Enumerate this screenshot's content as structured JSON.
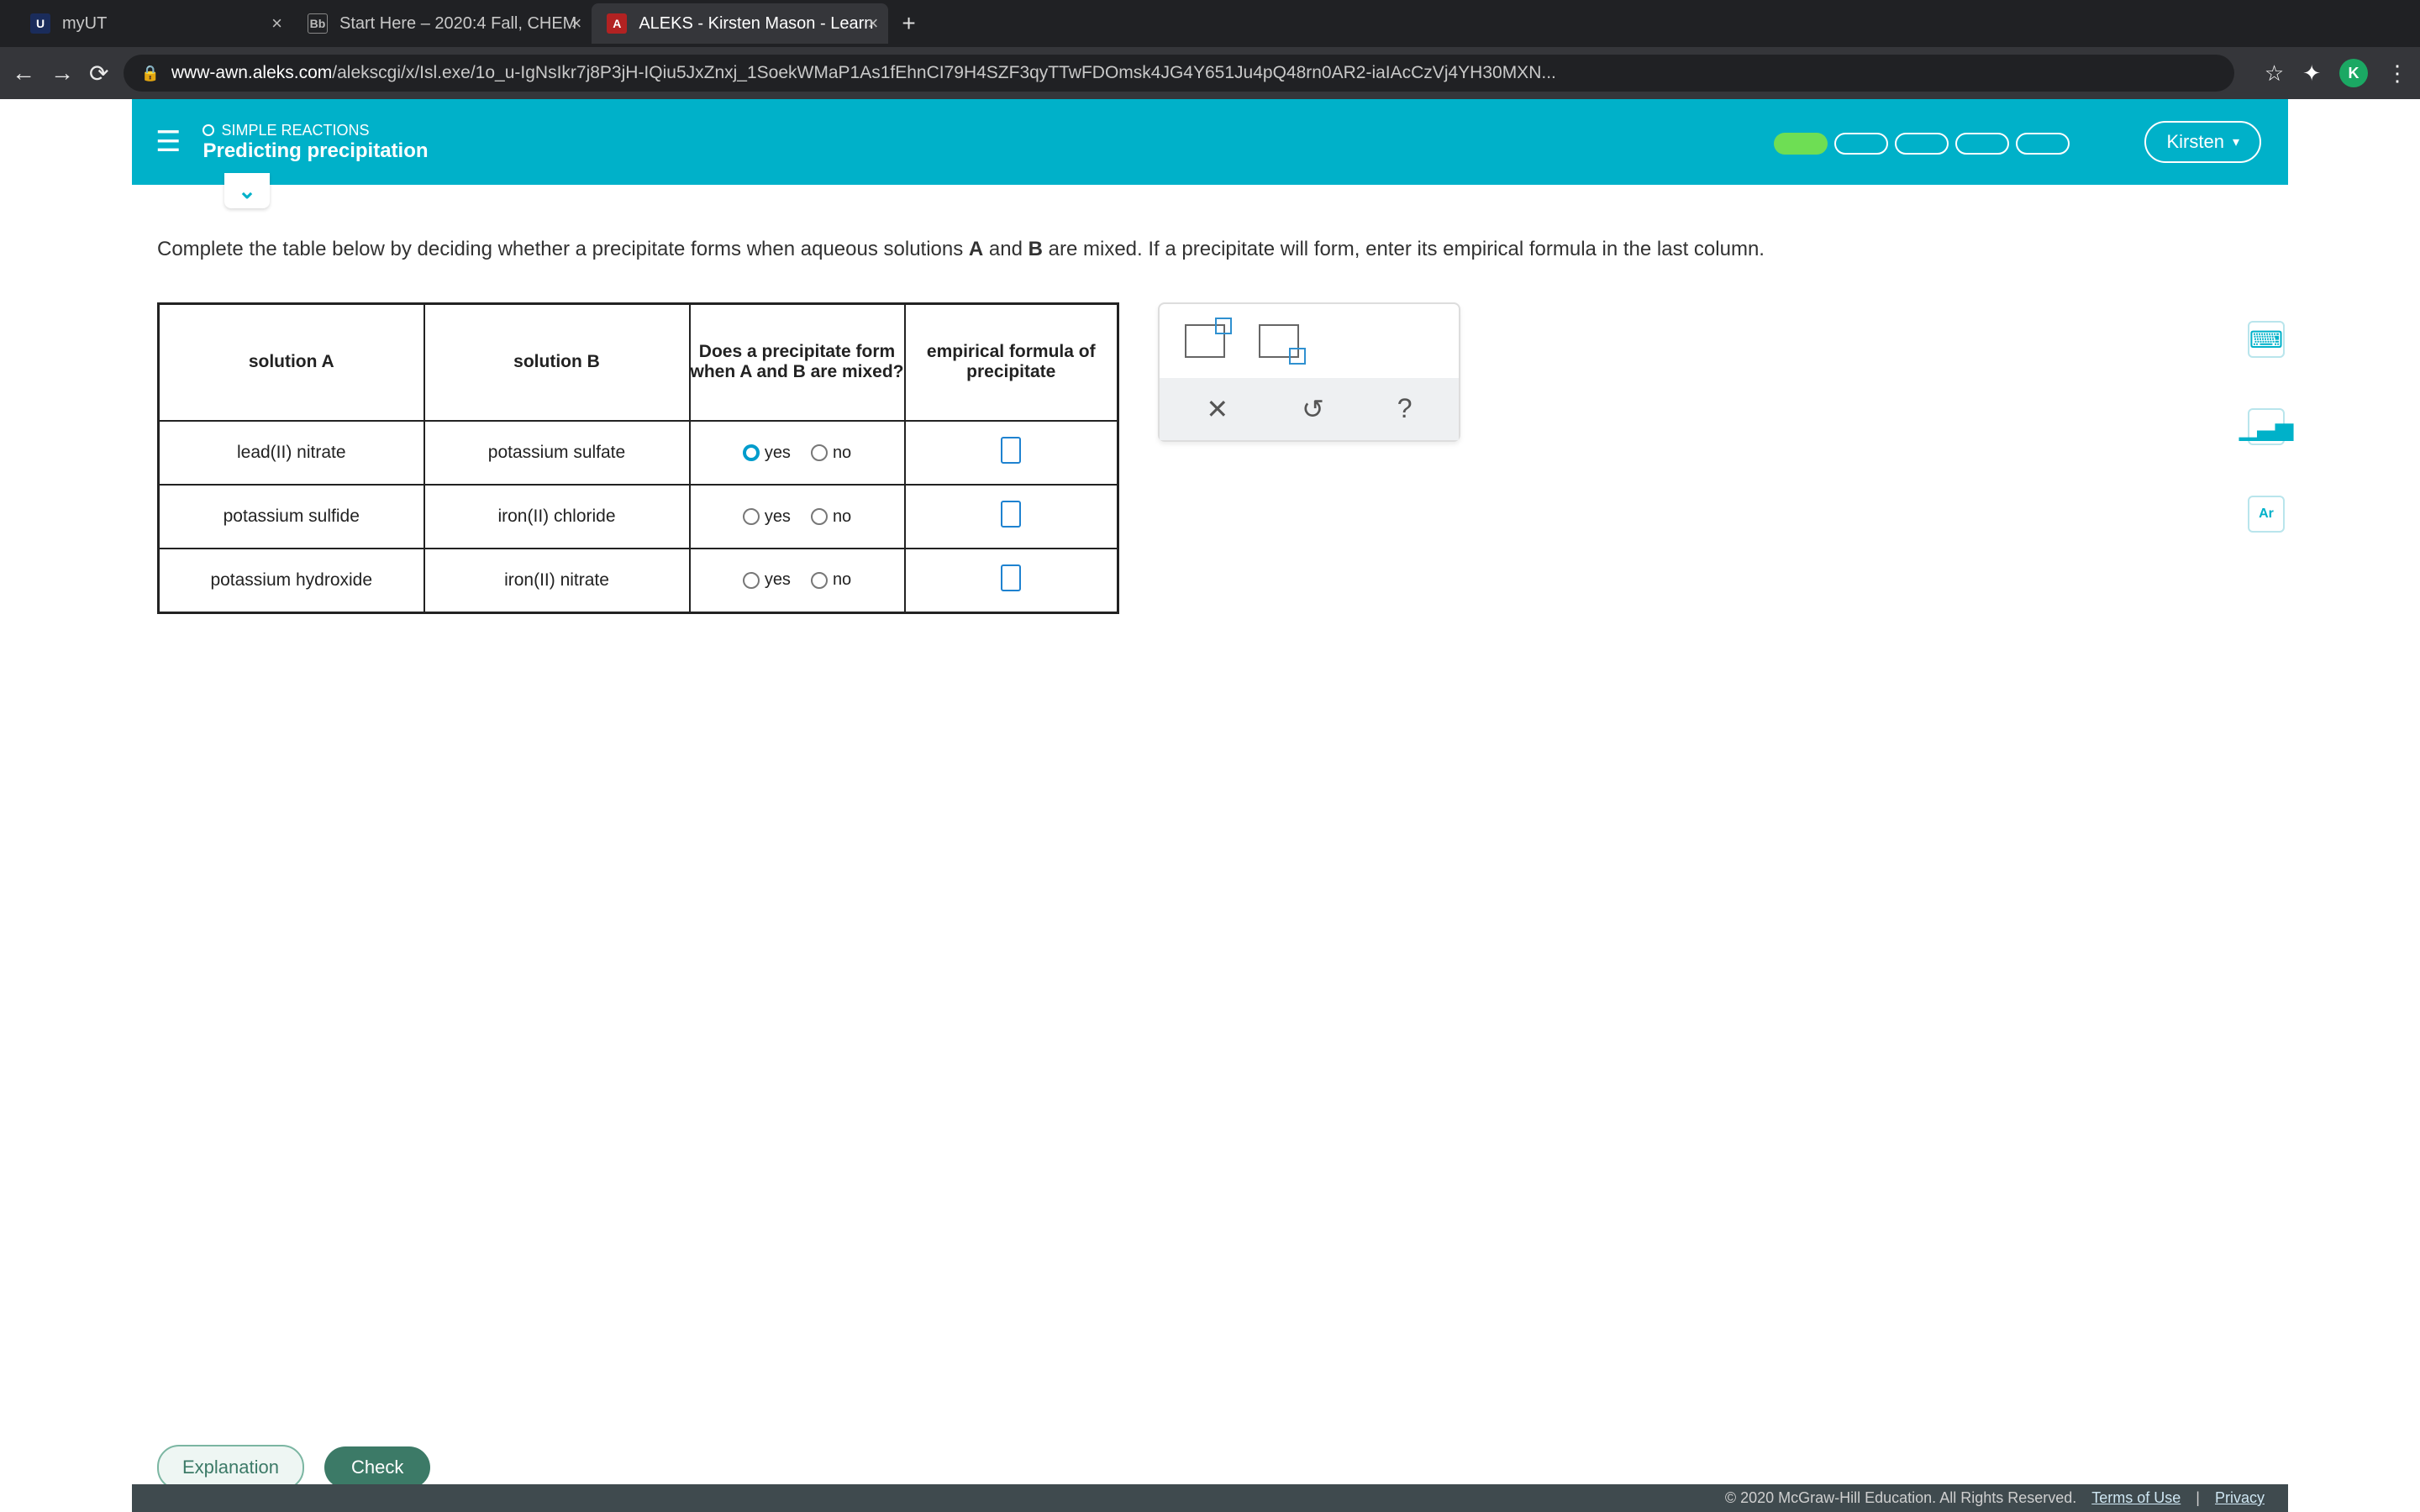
{
  "browser": {
    "tabs": [
      {
        "label": "myUT"
      },
      {
        "label": "Start Here – 2020:4 Fall, CHEM"
      },
      {
        "label": "ALEKS - Kirsten Mason - Learn"
      }
    ],
    "url_host": "www-awn.aleks.com",
    "url_path": "/alekscgi/x/Isl.exe/1o_u-IgNsIkr7j8P3jH-IQiu5JxZnxj_1SoekWMaP1As1fEhnCI79H4SZF3qyTTwFDOmsk4JG4Y651Ju4pQ48rn0AR2-iaIAcCzVj4YH30MXN...",
    "profile": "K"
  },
  "header": {
    "breadcrumb": "SIMPLE REACTIONS",
    "title": "Predicting precipitation",
    "user": "Kirsten"
  },
  "instruction": "Complete the table below by deciding whether a precipitate forms when aqueous solutions A and B are mixed. If a precipitate will form, enter its empirical formula in the last column.",
  "table": {
    "headers": {
      "a": "solution A",
      "b": "solution B",
      "q": "Does a precipitate form when A and B are mixed?",
      "f": "empirical formula of precipitate"
    },
    "yes": "yes",
    "no": "no",
    "rows": [
      {
        "a": "lead(II) nitrate",
        "b": "potassium sulfate",
        "selected": "yes"
      },
      {
        "a": "potassium sulfide",
        "b": "iron(II) chloride",
        "selected": ""
      },
      {
        "a": "potassium hydroxide",
        "b": "iron(II) nitrate",
        "selected": ""
      }
    ]
  },
  "palette": {
    "close": "✕",
    "undo": "↺",
    "help": "?"
  },
  "tools": {
    "calc": "⌨",
    "stats": "▁▃▅",
    "ar": "Ar"
  },
  "footer": {
    "explanation": "Explanation",
    "check": "Check",
    "copyright": "© 2020 McGraw-Hill Education. All Rights Reserved.",
    "terms": "Terms of Use",
    "privacy": "Privacy"
  }
}
